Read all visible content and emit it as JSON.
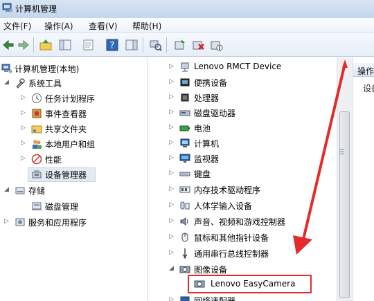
{
  "window": {
    "title": "计算机管理"
  },
  "menu": [
    "文件(F)",
    "操作(A)",
    "查看(V)",
    "帮助(H)"
  ],
  "toolbar": {
    "icons": [
      "back-icon",
      "forward-icon",
      "up-folder-icon",
      "console-tree-icon",
      "export-icon",
      "help-icon",
      "show-hide-icon",
      "scan-hardware-icon",
      "update-driver-icon",
      "uninstall-icon",
      "disable-icon"
    ]
  },
  "tree": {
    "root": "计算机管理(本地)",
    "system_tools": "系统工具",
    "task_scheduler": "任务计划程序",
    "event_viewer": "事件查看器",
    "shared_folders": "共享文件夹",
    "local_users": "本地用户和组",
    "performance": "性能",
    "device_manager": "设备管理器",
    "storage": "存储",
    "disk_management": "磁盘管理",
    "services_apps": "服务和应用程序"
  },
  "devices": {
    "items": [
      "Lenovo RMCT Device",
      "便携设备",
      "处理器",
      "磁盘驱动器",
      "电池",
      "计算机",
      "监视器",
      "键盘",
      "内存技术驱动程序",
      "人体学输入设备",
      "声音、视频和游戏控制器",
      "鼠标和其他指针设备",
      "通用串行总线控制器",
      "图像设备"
    ],
    "camera": "Lenovo EasyCamera",
    "partial_next": "网络适配器"
  },
  "actions_pane": {
    "header": "操作",
    "sub": "设备"
  },
  "colors": {
    "highlight_box": "#e32b2b",
    "arrow": "#e32b2b"
  }
}
